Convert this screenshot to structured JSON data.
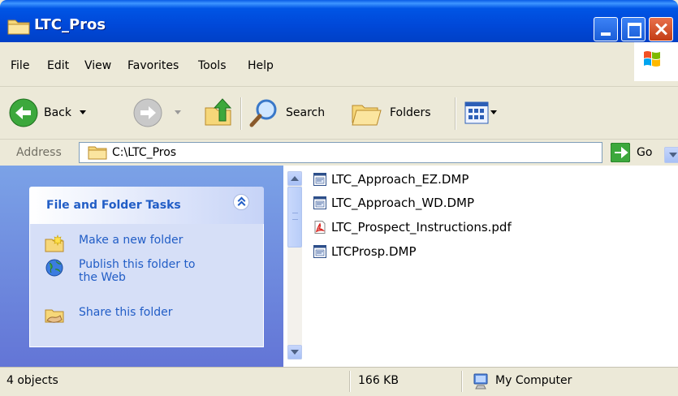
{
  "window": {
    "title": "LTC_Pros"
  },
  "menu": [
    "File",
    "Edit",
    "View",
    "Favorites",
    "Tools",
    "Help"
  ],
  "toolbar": {
    "back": "Back",
    "search": "Search",
    "folders": "Folders"
  },
  "address": {
    "label": "Address",
    "path": "C:\\LTC_Pros",
    "go": "Go"
  },
  "tasks": {
    "header": "File and Folder Tasks",
    "items": [
      {
        "label": "Make a new folder",
        "icon": "new-folder-icon"
      },
      {
        "label": "Publish this folder to the Web",
        "icon": "globe-icon"
      },
      {
        "label": "Share this folder",
        "icon": "share-folder-icon"
      }
    ]
  },
  "files": [
    {
      "name": "LTC_Approach_EZ.DMP",
      "icon": "dmp-file-icon"
    },
    {
      "name": "LTC_Approach_WD.DMP",
      "icon": "dmp-file-icon"
    },
    {
      "name": "LTC_Prospect_Instructions.pdf",
      "icon": "pdf-file-icon"
    },
    {
      "name": "LTCProsp.DMP",
      "icon": "dmp-file-icon"
    }
  ],
  "status": {
    "objects": "4 objects",
    "size": "166 KB",
    "location": "My Computer"
  }
}
